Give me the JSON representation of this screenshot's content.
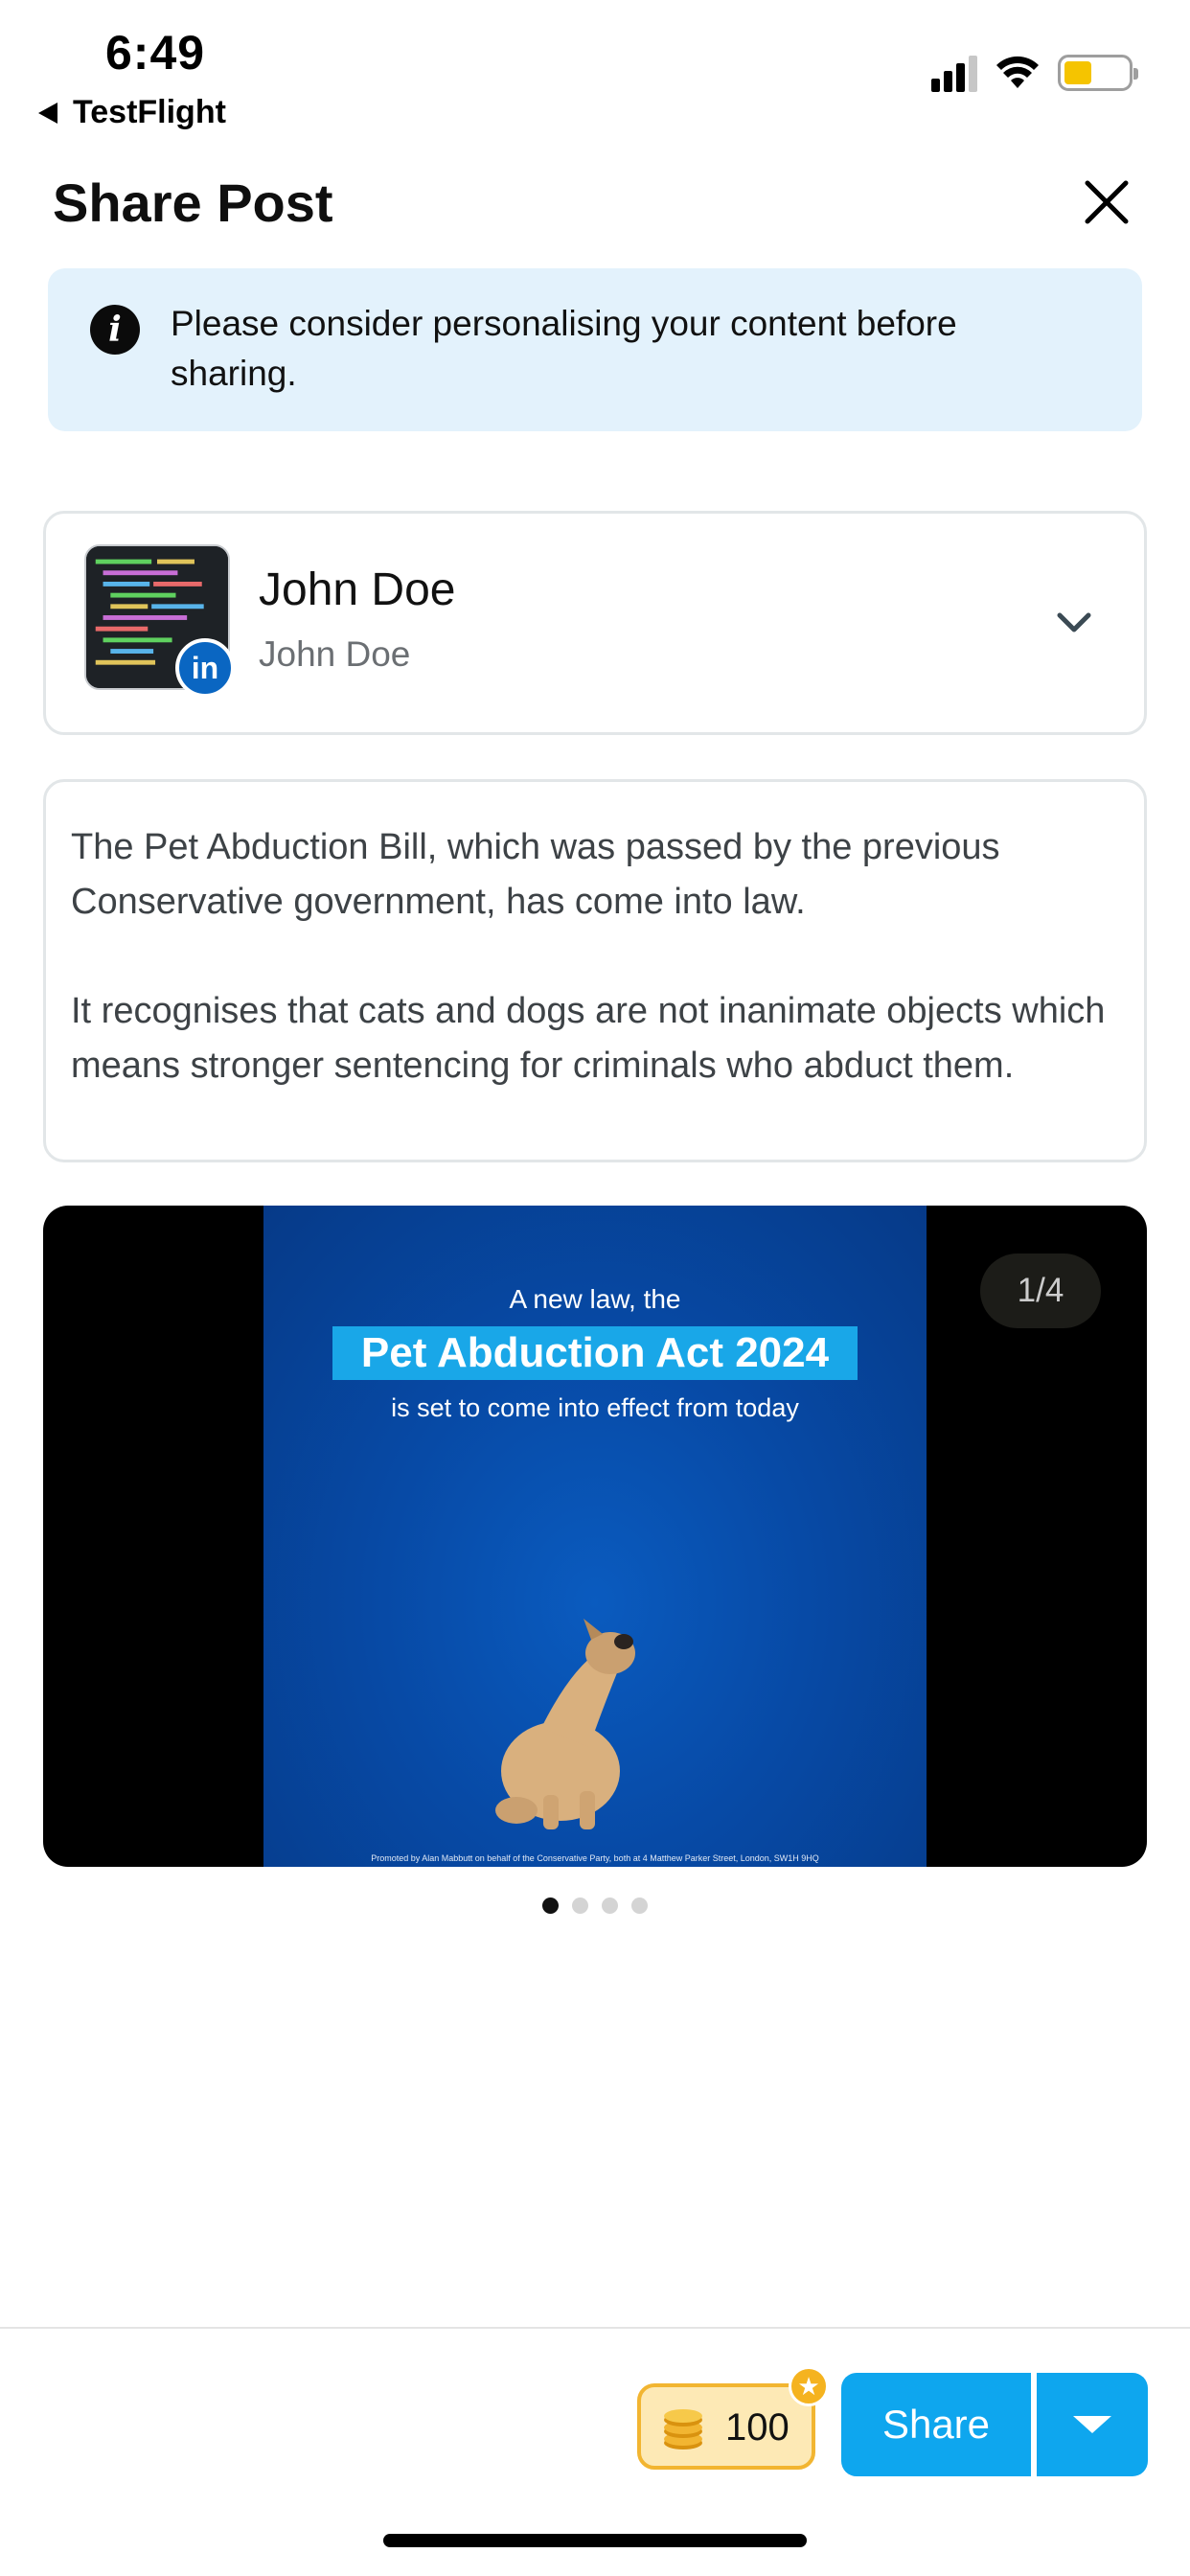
{
  "status_bar": {
    "time": "6:49",
    "back_app": "TestFlight"
  },
  "header": {
    "title": "Share Post"
  },
  "notice": {
    "text": "Please consider personalising your content before sharing."
  },
  "account": {
    "name": "John Doe",
    "subtitle": "John Doe",
    "network_badge": "in"
  },
  "post": {
    "text": "The Pet Abduction Bill, which was passed by the previous Conservative government, has come into law.\n\nIt recognises that cats and dogs are not inanimate objects which means stronger sentencing for criminals who abduct them."
  },
  "media": {
    "counter": "1/4",
    "slide_line1": "A new law, the",
    "slide_highlight": "Pet Abduction Act 2024",
    "slide_line3": "is set to come into effect from today",
    "slide_footer": "Promoted by Alan Mabbutt on behalf of the Conservative Party, both at 4 Matthew Parker Street, London, SW1H 9HQ"
  },
  "coins": {
    "value": "100"
  },
  "actions": {
    "share_label": "Share"
  },
  "colors": {
    "accent": "#0ea6ee",
    "notice_bg": "#e3f2fc",
    "coin_bg": "#fde9b5",
    "linkedin": "#0a66c2"
  }
}
